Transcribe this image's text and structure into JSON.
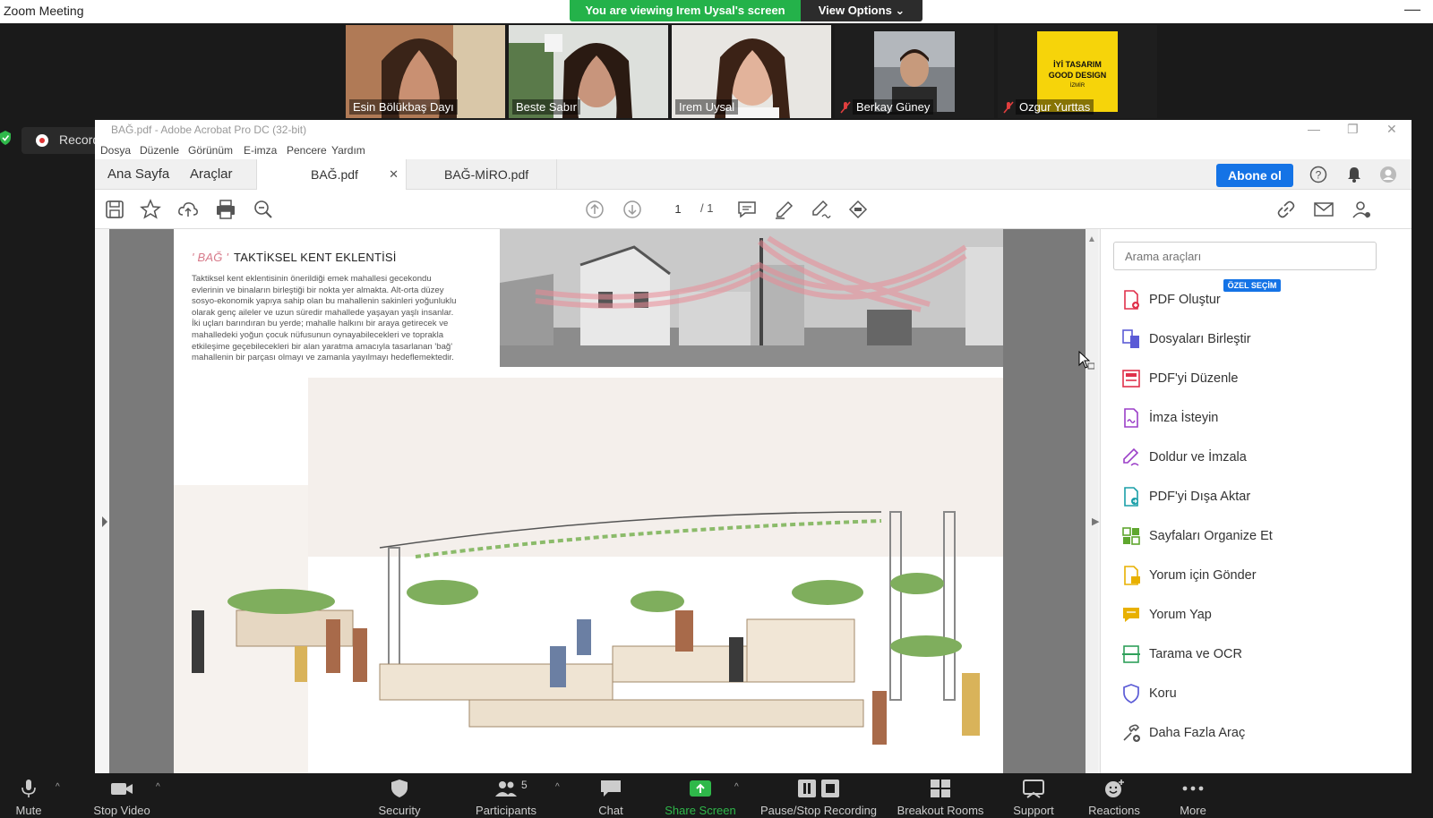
{
  "zoom": {
    "window_title": "Zoom Meeting",
    "viewing_banner": "You are viewing Irem Uysal's screen",
    "view_options": "View Options ⌄",
    "recording_label": "Recording...",
    "participants": [
      {
        "name": "Esin Bölükbaş Dayı",
        "muted": false
      },
      {
        "name": "Beste Sabır",
        "muted": false,
        "active": true
      },
      {
        "name": "Irem Uysal",
        "muted": false
      },
      {
        "name": "Berkay Güney",
        "muted": true
      },
      {
        "name": "Ozgur Yurttas",
        "muted": true
      }
    ],
    "toolbar": {
      "mute": "Mute",
      "stop_video": "Stop Video",
      "security": "Security",
      "participants": "Participants",
      "participants_count": "5",
      "chat": "Chat",
      "share_screen": "Share Screen",
      "pause_recording": "Pause/Stop Recording",
      "breakout": "Breakout Rooms",
      "support": "Support",
      "reactions": "Reactions",
      "more": "More"
    },
    "colors": {
      "green": "#24b24a",
      "dark": "#1a1a1a"
    }
  },
  "acrobat": {
    "title": "BAĞ.pdf - Adobe Acrobat Pro DC (32-bit)",
    "menu": [
      "Dosya",
      "Düzenle",
      "Görünüm",
      "E-imza",
      "Pencere",
      "Yardım"
    ],
    "nav_tabs": [
      "Ana Sayfa",
      "Araçlar"
    ],
    "doc_tabs": [
      {
        "label": "BAĞ.pdf",
        "active": true
      },
      {
        "label": "BAĞ-MİRO.pdf",
        "active": false
      }
    ],
    "subscribe": "Abone ol",
    "page_current": "1",
    "page_total": "/ 1",
    "search_placeholder": "Arama araçları",
    "special_badge": "ÖZEL SEÇİM",
    "tools": [
      {
        "label": "PDF Oluştur",
        "icon": "create-pdf-icon",
        "color": "#e0314b"
      },
      {
        "label": "Dosyaları Birleştir",
        "icon": "combine-files-icon",
        "color": "#5b5bd6"
      },
      {
        "label": "PDF'yi Düzenle",
        "icon": "edit-pdf-icon",
        "color": "#e0314b"
      },
      {
        "label": "İmza İsteyin",
        "icon": "request-signature-icon",
        "color": "#9b3fc8"
      },
      {
        "label": "Doldur ve İmzala",
        "icon": "fill-sign-icon",
        "color": "#9b3fc8"
      },
      {
        "label": "PDF'yi Dışa Aktar",
        "icon": "export-pdf-icon",
        "color": "#1a9fa8"
      },
      {
        "label": "Sayfaları Organize Et",
        "icon": "organize-pages-icon",
        "color": "#5fa72f"
      },
      {
        "label": "Yorum için Gönder",
        "icon": "send-comment-icon",
        "color": "#e8b000"
      },
      {
        "label": "Yorum Yap",
        "icon": "comment-icon",
        "color": "#e8b000"
      },
      {
        "label": "Tarama ve OCR",
        "icon": "scan-ocr-icon",
        "color": "#2fa05a"
      },
      {
        "label": "Koru",
        "icon": "protect-icon",
        "color": "#5b5bd6"
      },
      {
        "label": "Daha Fazla Araç",
        "icon": "more-tools-icon",
        "color": "#555555"
      }
    ]
  },
  "document": {
    "title_prefix": "' BAĞ '",
    "title": "TAKTİKSEL KENT EKLENTİSİ",
    "body_lines": [
      "Taktiksel kent eklentisinin önerildiği emek mahallesi gecekondu",
      "evlerinin ve binaların birleştiği bir nokta yer almakta. Alt-orta düzey",
      "sosyo-ekonomik yapıya sahip olan bu mahallenin sakinleri yoğunluklu",
      "olarak genç aileler ve uzun süredir mahallede yaşayan yaşlı  insanlar.",
      "İki uçları barındıran bu yerde; mahalle halkını bir araya getirecek ve",
      "mahalledeki yoğun çocuk nüfusunun oynayabilecekleri ve toprakla",
      "etkileşime geçebilecekleri bir alan yaratma amacıyla tasarlanan  'bağ'",
      "mahallenin bir parçası olmayı ve zamanla yayılmayı hedeflemektedir."
    ]
  }
}
